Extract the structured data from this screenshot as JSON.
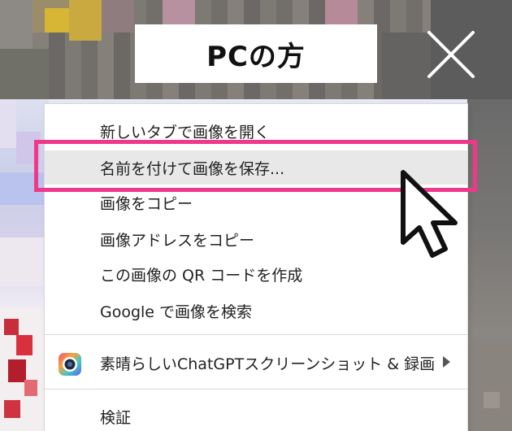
{
  "title_banner": {
    "text": "PCの方"
  },
  "close_button": {
    "icon": "close-icon"
  },
  "context_menu": {
    "items": [
      {
        "label": "新しいタブで画像を開く"
      },
      {
        "label": "名前を付けて画像を保存..."
      },
      {
        "label": "画像をコピー"
      },
      {
        "label": "画像アドレスをコピー"
      },
      {
        "label": "この画像の QR コードを作成"
      },
      {
        "label": "Google で画像を検索"
      },
      {
        "label": "素晴らしいChatGPTスクリーンショット & 録画",
        "icon": "extension-icon",
        "has_submenu": true
      },
      {
        "label": "検証"
      }
    ],
    "highlighted_item": "名前を付けて画像を保存...",
    "highlight_color": "#f0388a"
  },
  "cursor": {
    "icon": "mouse-pointer-icon"
  }
}
